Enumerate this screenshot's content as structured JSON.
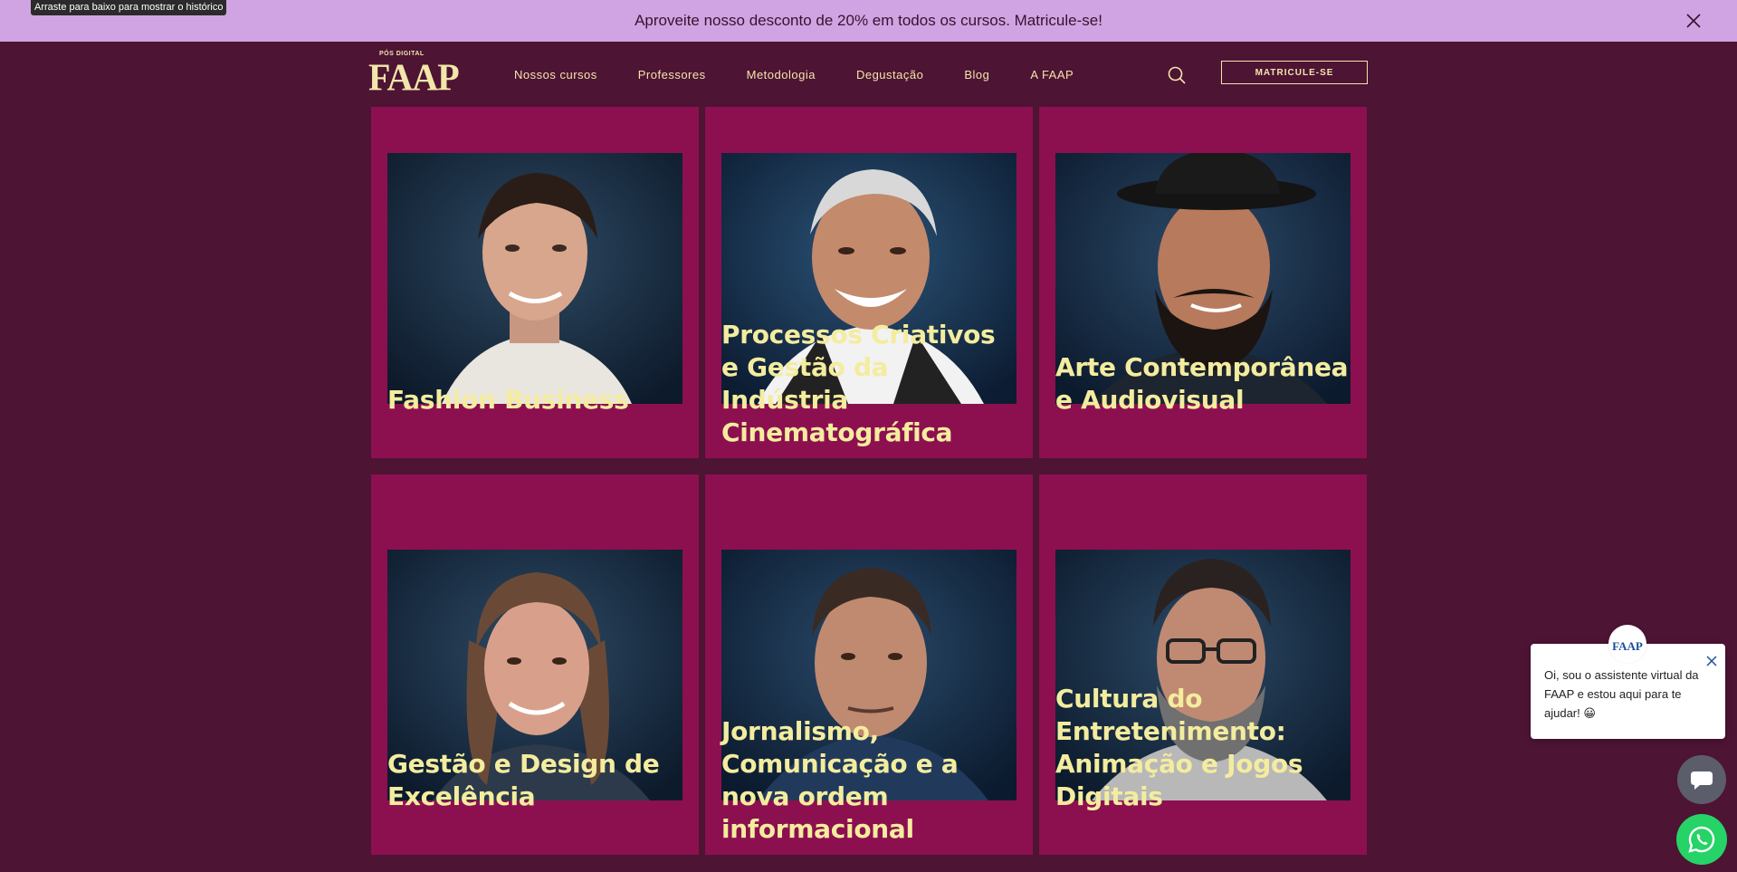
{
  "tooltip": "Arraste para baixo para mostrar o histórico",
  "promo": {
    "text": "Aproveite nosso desconto de 20% em todos os cursos. Matricule-se!"
  },
  "header": {
    "logo_small": "PÓS DIGITAL",
    "logo_big": "FAAP",
    "nav": [
      "Nossos cursos",
      "Professores",
      "Metodologia",
      "Degustação",
      "Blog",
      "A FAAP"
    ],
    "cta_label": "MATRICULE-SE"
  },
  "courses": [
    {
      "title": "Fashion Business"
    },
    {
      "title": "Processos Criativos e Gestão da Indústria Cinematográfica"
    },
    {
      "title": "Arte Contemporânea e Audiovisual"
    },
    {
      "title": "Gestão e Design de Excelência"
    },
    {
      "title": "Jornalismo, Comunicação e a nova ordem informacional"
    },
    {
      "title": "Cultura do Entretenimento: Animação e Jogos Digitais"
    }
  ],
  "chat": {
    "avatar_label": "FAAP",
    "message": "Oi, sou o assistente virtual da FAAP e estou aqui para te ajudar! 😀"
  },
  "colors": {
    "page_bg": "#4d1434",
    "card_bg": "#8c1050",
    "promo_bg": "#d0a4e2",
    "accent_text": "#f4ec9e",
    "whatsapp": "#25d366"
  }
}
